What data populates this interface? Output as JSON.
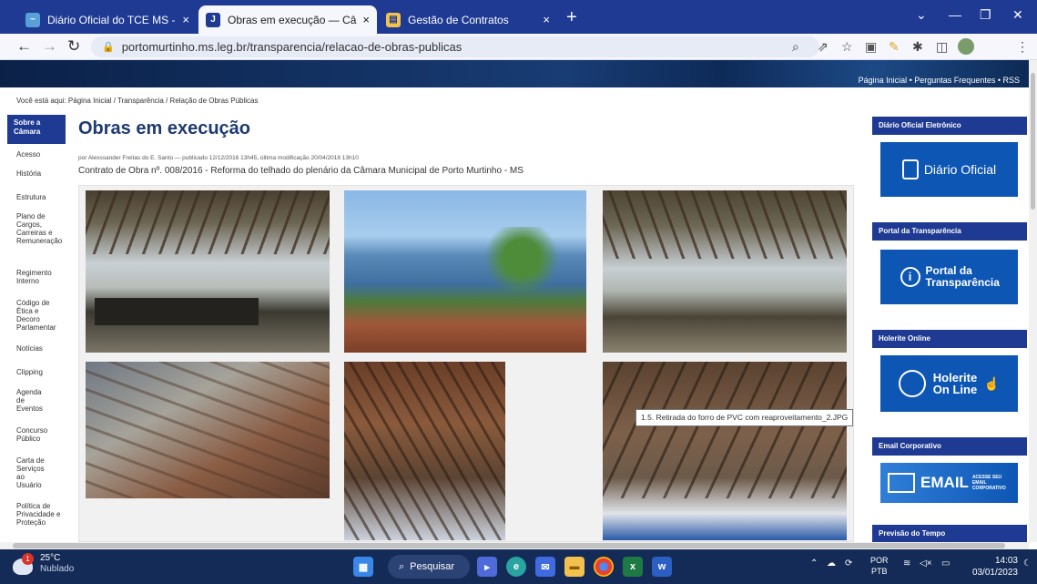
{
  "browser": {
    "tabs": [
      {
        "title": "Diário Oficial do TCE MS - TCE-M",
        "close": "×"
      },
      {
        "title": "Obras em execução — Câmara M",
        "close": "×"
      },
      {
        "title": "Gestão de Contratos",
        "close": "×"
      }
    ],
    "new_tab": "+",
    "url": "portomurtinho.ms.leg.br/transparencia/relacao-de-obras-publicas",
    "window_controls": {
      "dropdown": "⌄",
      "minimize": "—",
      "restore": "❐",
      "close": "✕"
    }
  },
  "page": {
    "top_links": "Página Inicial  •  Perguntas Frequentes  •  RSS",
    "breadcrumb": "Você está aqui: Página Inicial / Transparência / Relação de Obras Públicas",
    "left_nav": {
      "heading": "Sobre a Câmara",
      "items": [
        "Acesso",
        "História",
        "Estrutura",
        "Plano de Cargos, Carreiras e Remuneração",
        "Regimento Interno",
        "Código de Ética e Decoro Parlamentar",
        "Notícias",
        "Clipping",
        "Agenda de Eventos",
        "Concurso Público",
        "Carta de Serviços ao Usuário",
        "Política de Privacidade e Proteção"
      ]
    },
    "title": "Obras em execução",
    "byline": "por Alexssander Freitas do E. Santo — publicado 12/12/2016 13h45, última modificação 20/04/2018 13h10",
    "subtitle": "Contrato de Obra nº. 008/2016 - Reforma do telhado do plenário da Câmara Municipal de Porto Murtinho - MS",
    "tooltip": "1.5. Retirada do forro de PVC com reaproveitamento_2.JPG",
    "widgets": [
      {
        "heading": "Diário Oficial Eletrônico",
        "label": "Diário Oficial"
      },
      {
        "heading": "Portal da Transparência",
        "label": "Portal da Transparência"
      },
      {
        "heading": "Holerite Online",
        "label": "Holerite On Line"
      },
      {
        "heading": "Email Corporativo",
        "label": "EMAIL",
        "sub": "ACESSE SEU EMAIL CORPORATIVO"
      },
      {
        "heading": "Previsão do Tempo"
      }
    ]
  },
  "taskbar": {
    "weather_temp": "25°C",
    "weather_desc": "Nublado",
    "weather_badge": "1",
    "search_label": "Pesquisar",
    "lang_top": "POR",
    "lang_bottom": "PTB",
    "time": "14:03",
    "date": "03/01/2023"
  },
  "colors": {
    "brand": "#1f3a93",
    "widget_blue": "#0d56b4",
    "taskbar": "#142b57"
  }
}
